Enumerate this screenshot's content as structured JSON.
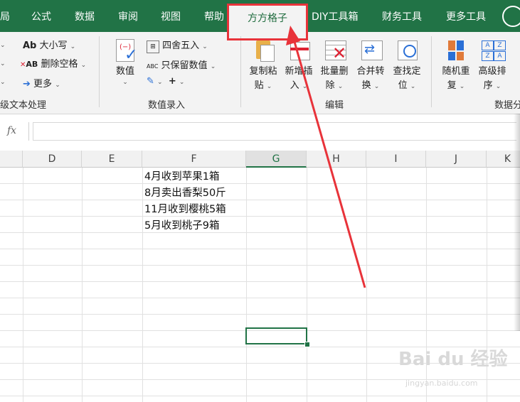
{
  "tabs": [
    {
      "label": "局"
    },
    {
      "label": "公式"
    },
    {
      "label": "数据"
    },
    {
      "label": "审阅"
    },
    {
      "label": "视图"
    },
    {
      "label": "帮助"
    },
    {
      "label": "方方格子"
    },
    {
      "label": "DIY工具箱"
    },
    {
      "label": "财务工具"
    },
    {
      "label": "更多工具"
    }
  ],
  "ribbon": {
    "text_group": {
      "case_label": "大小写",
      "case_icon_text": "Ab",
      "remove_spaces_label": "删除空格",
      "remove_spaces_icon_text": "AB",
      "more_label": "更多",
      "group_label": "级文本处理"
    },
    "number_group": {
      "value_label": "数值",
      "round_label": "四舍五入",
      "keep_value_label": "只保留数值",
      "keep_value_icon_text": "ABC",
      "group_label": "数值录入"
    },
    "edit_group": {
      "copy_paste_label": [
        "复制粘",
        "贴"
      ],
      "new_insert_label": [
        "新增插",
        "入"
      ],
      "batch_delete_label": [
        "批量删",
        "除"
      ],
      "merge_convert_label": [
        "合并转",
        "换"
      ],
      "find_locate_label": [
        "查找定",
        "位"
      ],
      "group_label": "编辑"
    },
    "data_group": {
      "random_repeat_label": [
        "随机重",
        "复"
      ],
      "advanced_sort_label": [
        "高级排",
        "序"
      ],
      "group_label": "数据分"
    }
  },
  "formula_bar": {
    "fx_label": "fx",
    "value": ""
  },
  "columns": [
    "D",
    "E",
    "F",
    "G",
    "H",
    "I",
    "J",
    "K"
  ],
  "selected_column": "G",
  "cells": [
    "4月收到苹果1箱",
    "8月卖出香梨50斤",
    "11月收到樱桃5箱",
    "5月收到桃子9箱"
  ],
  "watermark": {
    "logo": "Bai du 经验",
    "url": "jingyan.baidu.com"
  },
  "colors": {
    "accent": "#217346",
    "highlight": "#e8333a"
  }
}
